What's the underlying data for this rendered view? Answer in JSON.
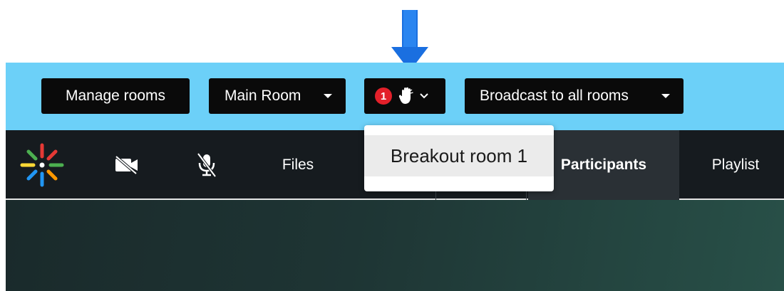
{
  "toolbar": {
    "manage_rooms": "Manage rooms",
    "main_room": "Main Room",
    "hand_count": "1",
    "broadcast": "Broadcast to all rooms"
  },
  "nav": {
    "files": "Files",
    "participants": "Participants",
    "playlist": "Playlist"
  },
  "dropdown": {
    "items": [
      "Breakout room 1"
    ]
  },
  "colors": {
    "toolbar_bg": "#6cd0f8",
    "navbar_bg": "#161b1f",
    "badge": "#e3202a",
    "arrow": "#1a6fe0"
  },
  "icons": [
    "down-arrow-annotation-icon",
    "caret-down-icon",
    "raised-hand-icon",
    "chevron-down-icon",
    "app-logo-icon",
    "video-off-icon",
    "mic-off-icon"
  ]
}
